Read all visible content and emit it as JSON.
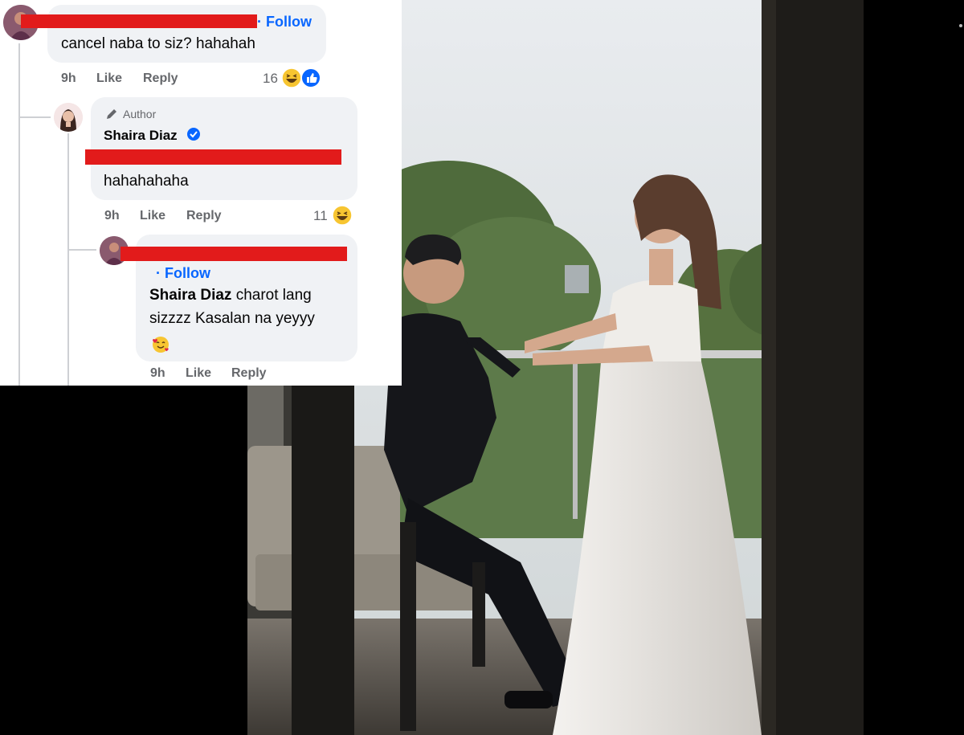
{
  "comments": [
    {
      "id": "c1",
      "follow_label": "· Follow",
      "text": "cancel naba to siz? hahahah",
      "time": "9h",
      "like_label": "Like",
      "reply_label": "Reply",
      "reaction_count": "16",
      "reactions": [
        "haha-icon",
        "like-icon"
      ]
    },
    {
      "id": "c2",
      "author_badge": "Author",
      "name": "Shaira Diaz",
      "verified": true,
      "text": "hahahahaha",
      "time": "9h",
      "like_label": "Like",
      "reply_label": "Reply",
      "reaction_count": "11",
      "reactions": [
        "haha-icon"
      ]
    },
    {
      "id": "c3",
      "follow_label": "· Follow",
      "mention": "Shaira Diaz",
      "text_line1": " charot lang",
      "text_line2": "sizzzz Kasalan na yeyyy",
      "emoji_line": "smiling-face-with-hearts-icon",
      "time": "9h",
      "like_label": "Like",
      "reply_label": "Reply"
    }
  ],
  "colors": {
    "link_blue": "#0866ff",
    "bubble_bg": "#f0f2f5",
    "meta_gray": "#65676b",
    "redaction_red": "#e21b1b"
  }
}
